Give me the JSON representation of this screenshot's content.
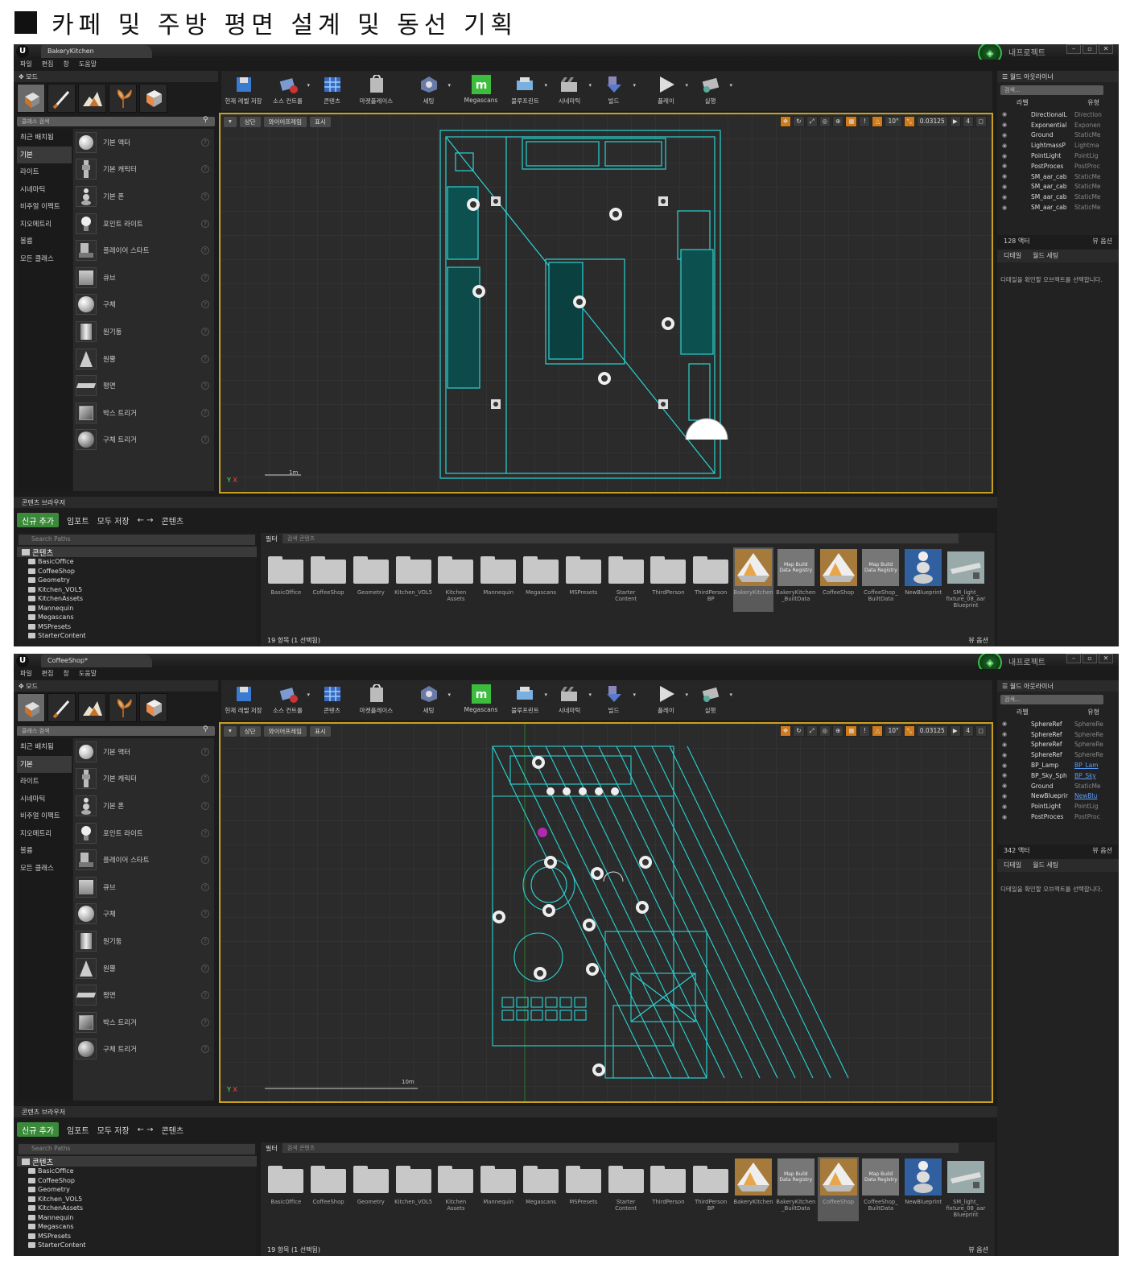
{
  "heading": "카페 및 주방 평면 설계 및 동선 기획",
  "project_label": "내프로젝트",
  "menu": [
    "파일",
    "편집",
    "창",
    "도움말"
  ],
  "modes_label": "모드",
  "search_classes": "클래스 검색",
  "categories": [
    "최근 배치됨",
    "기본",
    "라이트",
    "시네마틱",
    "비주얼 이펙트",
    "지오메트리",
    "볼륨",
    "모든 클래스"
  ],
  "place_items": [
    "기본 액터",
    "기본 캐릭터",
    "기본 폰",
    "포인트 라이트",
    "플레이어 스타트",
    "큐브",
    "구체",
    "원기둥",
    "원뿔",
    "평면",
    "박스 트리거",
    "구체 트리거"
  ],
  "toolbar": [
    "현재 레벨 저장",
    "소스 컨트롤",
    "콘텐츠",
    "마켓플레이스",
    "세팅",
    "Megascans",
    "블루프린트",
    "시네마틱",
    "빌드",
    "플레이",
    "실행"
  ],
  "viewport": {
    "view": "상단",
    "mode": "와이어프레임",
    "show": "표시",
    "grid": "10°",
    "scale": "0.03125",
    "speed": "4"
  },
  "outliner": {
    "title": "월드 아웃라이너",
    "search": "검색...",
    "col_label": "라벨",
    "col_type": "유형"
  },
  "details": {
    "tab1": "디테일",
    "tab2": "월드 세팅",
    "msg": "디테일을 확인할 오브젝트를 선택합니다."
  },
  "content_browser": {
    "title": "콘텐츠 브라우저",
    "add_new": "신규 추가",
    "import": "임포트",
    "save_all": "모두 저장",
    "path": "콘텐츠",
    "search_paths": "Search Paths",
    "filter": "필터",
    "search_content": "검색 콘텐츠",
    "root": "콘텐츠",
    "tree": [
      "BasicOffice",
      "CoffeeShop",
      "Geometry",
      "Kitchen_VOL5",
      "KitchenAssets",
      "Mannequin",
      "Megascans",
      "MSPresets",
      "StarterContent"
    ],
    "assets": [
      "BasicOffice",
      "CoffeeShop",
      "Geometry",
      "Kitchen_VOL5",
      "Kitchen\nAssets",
      "Mannequin",
      "Megascans",
      "MSPresets",
      "Starter\nContent",
      "ThirdPerson",
      "ThirdPerson\nBP",
      "BakeryKitchen",
      "BakeryKitchen\n_BuiltData",
      "CoffeeShop",
      "CoffeeShop_\nBuiltData",
      "NewBlueprint",
      "SM_light_\nfixture_08_aar\nBlueprint"
    ],
    "map_build": "Map Build\nData Registry",
    "status": "19 항목 (1 선택됨)",
    "view_options": "뷰 옵션"
  },
  "panels": [
    {
      "tab": "BakeryKitchen",
      "scale_label": "1m",
      "actor_count": "128 액터",
      "outliner_rows": [
        [
          "DirectionalL",
          "Direction",
          false
        ],
        [
          "Exponential",
          "Exponen",
          false
        ],
        [
          "Ground",
          "StaticMe",
          false
        ],
        [
          "LightmassP",
          "Lightma",
          false
        ],
        [
          "PointLight",
          "PointLig",
          false
        ],
        [
          "PostProces",
          "PostProc",
          false
        ],
        [
          "SM_aar_cab",
          "StaticMe",
          false
        ],
        [
          "SM_aar_cab",
          "StaticMe",
          false
        ],
        [
          "SM_aar_cab",
          "StaticMe",
          false
        ],
        [
          "SM_aar_cab",
          "StaticMe",
          false
        ]
      ]
    },
    {
      "tab": "CoffeeShop*",
      "scale_label": "10m",
      "actor_count": "342 액터",
      "outliner_rows": [
        [
          "SphereRef",
          "SphereRe",
          false
        ],
        [
          "SphereRef",
          "SphereRe",
          false
        ],
        [
          "SphereRef",
          "SphereRe",
          false
        ],
        [
          "SphereRef",
          "SphereRe",
          false
        ],
        [
          "BP_Lamp",
          "BP_Lam",
          true
        ],
        [
          "BP_Sky_Sph",
          "BP_Sky",
          true
        ],
        [
          "Ground",
          "StaticMe",
          false
        ],
        [
          "NewBlueprir",
          "NewBlu",
          true
        ],
        [
          "PointLight",
          "PointLig",
          false
        ],
        [
          "PostProces",
          "PostProc",
          false
        ]
      ]
    }
  ],
  "colors": {
    "wire": "#2ad4d4",
    "accent_green": "#3a8a3a",
    "viewport_border": "#c8a020"
  }
}
